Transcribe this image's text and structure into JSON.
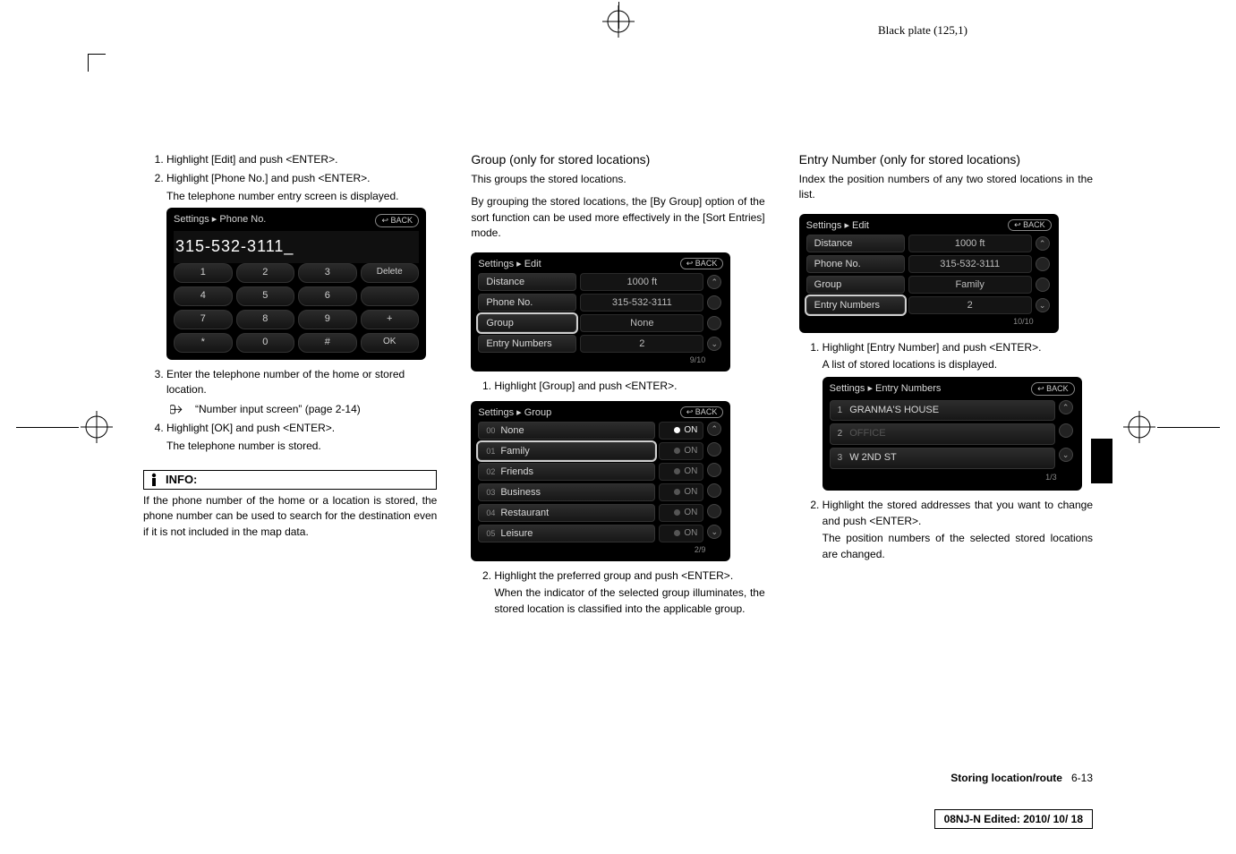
{
  "plate_label": "Black plate (125,1)",
  "col1": {
    "step1": "Highlight [Edit] and push <ENTER>.",
    "step2_a": "Highlight [Phone No.] and push <ENTER>.",
    "step2_b": "The telephone number entry screen is displayed.",
    "ui_phone": {
      "breadcrumb": "Settings ▸ Phone No.",
      "back": "↩ BACK",
      "display": "315-532-3111_",
      "keys": [
        "1",
        "2",
        "3",
        "Delete",
        "4",
        "5",
        "6",
        "",
        "7",
        "8",
        "9",
        "+",
        "*",
        "0",
        "#",
        "OK"
      ]
    },
    "step3_a": "Enter the telephone number of the home or stored location.",
    "ref": "“Number input screen” (page 2-14)",
    "step4_a": "Highlight [OK] and push <ENTER>.",
    "step4_b": "The telephone number is stored.",
    "info_label": "INFO:",
    "info_text": "If the phone number of the home or a location is stored, the phone number can be used to search for the destination even if it is not included in the map data."
  },
  "col2": {
    "heading": "Group (only for stored locations)",
    "p1": "This groups the stored locations.",
    "p2": "By grouping the stored locations, the [By Group] option of the sort function can be used more effectively in the [Sort Entries] mode.",
    "ui_edit": {
      "breadcrumb": "Settings ▸ Edit",
      "back": "↩ BACK",
      "rows": [
        {
          "label": "Distance",
          "value": "1000 ft"
        },
        {
          "label": "Phone No.",
          "value": "315-532-3111"
        },
        {
          "label": "Group",
          "value": "None",
          "hl": true
        },
        {
          "label": "Entry Numbers",
          "value": "2"
        }
      ],
      "footer": "9/10"
    },
    "step1": "Highlight [Group] and push <ENTER>.",
    "ui_group": {
      "breadcrumb": "Settings ▸ Group",
      "back": "↩ BACK",
      "rows": [
        {
          "n": "00",
          "label": "None",
          "active": true,
          "hl": false
        },
        {
          "n": "01",
          "label": "Family",
          "active": false,
          "hl": true
        },
        {
          "n": "02",
          "label": "Friends",
          "active": false
        },
        {
          "n": "03",
          "label": "Business",
          "active": false
        },
        {
          "n": "04",
          "label": "Restaurant",
          "active": false
        },
        {
          "n": "05",
          "label": "Leisure",
          "active": false
        }
      ],
      "on": "ON",
      "footer": "2/9"
    },
    "step2_a": "Highlight the preferred group and push <ENTER>.",
    "step2_b": "When the indicator of the selected group illuminates, the stored location is classified into the applicable group."
  },
  "col3": {
    "heading": "Entry Number (only for stored locations)",
    "p1": "Index the position numbers of any two stored locations in the list.",
    "ui_edit": {
      "breadcrumb": "Settings ▸ Edit",
      "back": "↩ BACK",
      "rows": [
        {
          "label": "Distance",
          "value": "1000 ft"
        },
        {
          "label": "Phone No.",
          "value": "315-532-3111"
        },
        {
          "label": "Group",
          "value": "Family"
        },
        {
          "label": "Entry Numbers",
          "value": "2",
          "hl": true
        }
      ],
      "footer": "10/10"
    },
    "step1_a": "Highlight [Entry Number] and push <ENTER>.",
    "step1_b": "A list of stored locations is displayed.",
    "ui_entry": {
      "breadcrumb": "Settings ▸ Entry Numbers",
      "back": "↩ BACK",
      "rows": [
        {
          "n": "1",
          "label": "GRANMA'S HOUSE"
        },
        {
          "n": "2",
          "label": "OFFICE",
          "dim": true
        },
        {
          "n": "3",
          "label": "W 2ND ST"
        }
      ],
      "footer": "1/3"
    },
    "step2_a": "Highlight the stored addresses that you want to change and push <ENTER>.",
    "step2_b": "The position numbers of the selected stored locations are changed."
  },
  "footer": {
    "section": "Storing location/route",
    "page": "6-13"
  },
  "edit_stamp": "08NJ-N Edited:  2010/ 10/ 18"
}
